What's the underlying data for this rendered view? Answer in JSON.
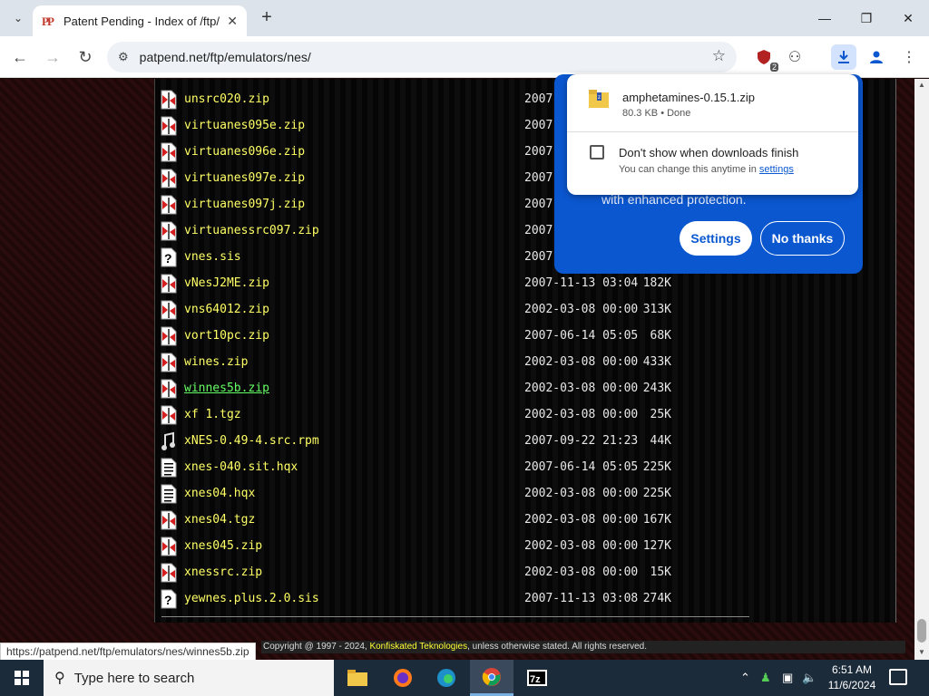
{
  "browser": {
    "tab_title": "Patent Pending - Index of /ftp/emulators/nes/",
    "url": "patpend.net/ftp/emulators/nes/",
    "extension_badge": "2"
  },
  "listing": {
    "rows": [
      {
        "name": "unsrc020.zip",
        "date": "2007-",
        "size": "",
        "icon": "zip-file-icon"
      },
      {
        "name": "virtuanes095e.zip",
        "date": "2007-",
        "size": "",
        "icon": "zip-file-icon"
      },
      {
        "name": "virtuanes096e.zip",
        "date": "2007-",
        "size": "",
        "icon": "zip-file-icon"
      },
      {
        "name": "virtuanes097e.zip",
        "date": "2007-",
        "size": "",
        "icon": "zip-file-icon"
      },
      {
        "name": "virtuanes097j.zip",
        "date": "2007-",
        "size": "",
        "icon": "zip-file-icon"
      },
      {
        "name": "virtuanessrc097.zip",
        "date": "2007-",
        "size": "",
        "icon": "zip-file-icon"
      },
      {
        "name": "vnes.sis",
        "date": "2007-",
        "size": "",
        "icon": "unknown-file-icon"
      },
      {
        "name": "vNesJ2ME.zip",
        "date": "2007-11-13 03:04",
        "size": "182K",
        "icon": "zip-file-icon"
      },
      {
        "name": "vns64012.zip",
        "date": "2002-03-08 00:00",
        "size": "313K",
        "icon": "zip-file-icon"
      },
      {
        "name": "vort10pc.zip",
        "date": "2007-06-14 05:05",
        "size": "68K",
        "icon": "zip-file-icon"
      },
      {
        "name": "wines.zip",
        "date": "2002-03-08 00:00",
        "size": "433K",
        "icon": "zip-file-icon"
      },
      {
        "name": "winnes5b.zip",
        "date": "2002-03-08 00:00",
        "size": "243K",
        "icon": "zip-file-icon",
        "hover": true
      },
      {
        "name": "xf   1.tgz",
        "date": "2002-03-08 00:00",
        "size": "25K",
        "icon": "zip-file-icon"
      },
      {
        "name": "xNES-0.49-4.src.rpm",
        "date": "2007-09-22 21:23",
        "size": "44K",
        "icon": "music-file-icon"
      },
      {
        "name": "xnes-040.sit.hqx",
        "date": "2007-06-14 05:05",
        "size": "225K",
        "icon": "text-file-icon"
      },
      {
        "name": "xnes04.hqx",
        "date": "2002-03-08 00:00",
        "size": "225K",
        "icon": "text-file-icon"
      },
      {
        "name": "xnes04.tgz",
        "date": "2002-03-08 00:00",
        "size": "167K",
        "icon": "zip-file-icon"
      },
      {
        "name": "xnes045.zip",
        "date": "2002-03-08 00:00",
        "size": "127K",
        "icon": "zip-file-icon"
      },
      {
        "name": "xnessrc.zip",
        "date": "2002-03-08 00:00",
        "size": "15K",
        "icon": "zip-file-icon"
      },
      {
        "name": "yewnes.plus.2.0.sis",
        "date": "2007-11-13 03:08",
        "size": "274K",
        "icon": "unknown-file-icon"
      }
    ]
  },
  "status_bar": {
    "hover_url": "https://patpend.net/ftp/emulators/nes/winnes5b.zip"
  },
  "footer": {
    "prefix": "Copyright @ 1997 - 2024, ",
    "link": "Konfiskated Teknologies",
    "suffix": ", unless otherwise stated. All rights reserved."
  },
  "promo": {
    "text": "with enhanced protection.",
    "settings_label": "Settings",
    "no_thanks_label": "No thanks"
  },
  "download_popup": {
    "file_name": "amphetamines-0.15.1.zip",
    "file_meta": "80.3 KB • Done",
    "checkbox_label": "Don't show when downloads finish",
    "hint_prefix": "You can change this anytime in ",
    "hint_link": "settings"
  },
  "taskbar": {
    "search_placeholder": "Type here to search",
    "time": "6:51 AM",
    "date": "11/6/2024"
  },
  "colors": {
    "file_link": "#ffff66",
    "hover_link": "#66ff66",
    "promo_blue": "#0b57d0"
  }
}
